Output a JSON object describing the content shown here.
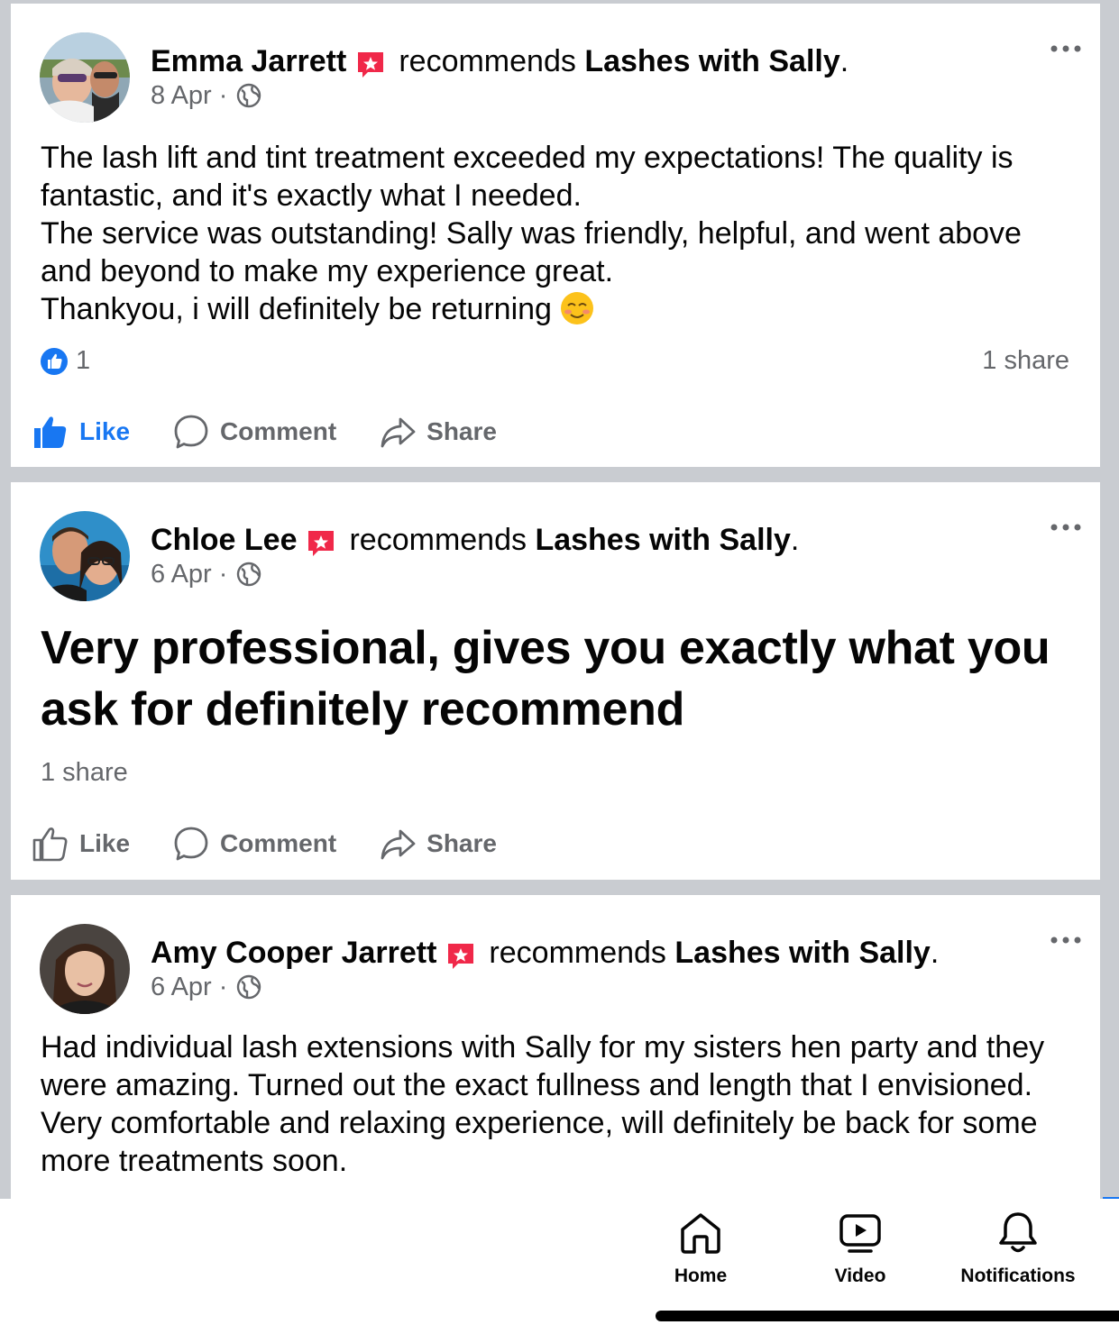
{
  "posts": [
    {
      "author": "Emma Jarrett",
      "action": "recommends",
      "page": "Lashes with Sally",
      "date": "8 Apr",
      "separator": "·",
      "body": [
        "The lash lift and tint treatment exceeded my expectations! The quality is fantastic, and it's exactly what I needed.",
        "The service was outstanding! Sally was friendly, helpful, and went above and beyond to make my experience great.",
        "Thankyou, i will definitely be returning"
      ],
      "emoji": "smiling-face-emoji",
      "reaction_count": "1",
      "shares": "1 share",
      "like_label": "Like",
      "comment_label": "Comment",
      "share_label": "Share",
      "liked": true
    },
    {
      "author": "Chloe Lee",
      "action": "recommends",
      "page": "Lashes with Sally",
      "date": "6 Apr",
      "separator": "·",
      "body": "Very professional, gives you exactly what you ask for definitely recommend",
      "shares": "1 share",
      "like_label": "Like",
      "comment_label": "Comment",
      "share_label": "Share",
      "liked": false
    },
    {
      "author": "Amy Cooper Jarrett",
      "action": "recommends",
      "page": "Lashes with Sally",
      "date": "6 Apr",
      "separator": "·",
      "body": "Had individual lash extensions with Sally for my sisters hen party and they were amazing. Turned out the exact fullness and length that I envisioned. Very comfortable and relaxing experience, will definitely be back for some more treatments soon."
    }
  ],
  "nav": {
    "home": "Home",
    "video": "Video",
    "notifications": "Notifications"
  },
  "colors": {
    "accent": "#1877f2",
    "secondary_text": "#65676b",
    "recommend_badge": "#f02849",
    "divider": "#c9ccd1"
  }
}
